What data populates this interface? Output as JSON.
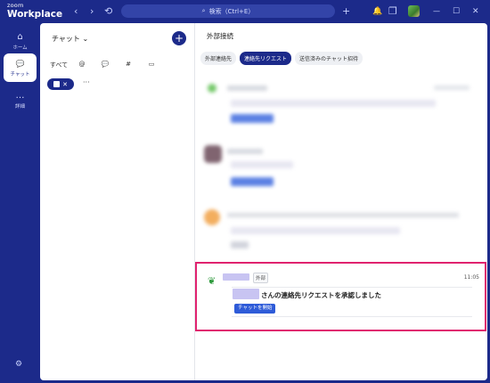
{
  "app": {
    "logo_line1": "zoom",
    "logo_line2": "Workplace"
  },
  "titlebar": {
    "search_placeholder": "検索（Ctrl+E）",
    "back_icon": "‹",
    "forward_icon": "›",
    "history_icon": "⟲",
    "add_icon": "+",
    "bell_icon": "🔔",
    "window_icon": "❐",
    "minimize_icon": "—",
    "maximize_icon": "☐",
    "close_icon": "✕"
  },
  "leftnav": {
    "items": [
      {
        "label": "ホーム",
        "icon": "⌂"
      },
      {
        "label": "チャット",
        "icon": "💬"
      },
      {
        "label": "詳細",
        "icon": "…"
      }
    ],
    "settings_icon": "⚙"
  },
  "chat_panel": {
    "title": "チャット",
    "title_chevron": "⌄",
    "new_button": "+",
    "filters": [
      "すべて",
      "@",
      "💬",
      "#",
      "▭"
    ],
    "chip_close": "✕",
    "more": "···"
  },
  "external": {
    "title": "外部接続",
    "tabs": [
      "外部連絡先",
      "連絡先リクエスト",
      "送信済みのチャット招待"
    ],
    "active_tab": 1,
    "highlighted_request": {
      "tag": "外部",
      "time": "11:05",
      "message": "さんの連絡先リクエストを承認しました",
      "button": "チャットを開始"
    }
  },
  "colors": {
    "brand": "#1c2a8a",
    "highlight": "#e0236f",
    "button": "#2e5bd8"
  }
}
